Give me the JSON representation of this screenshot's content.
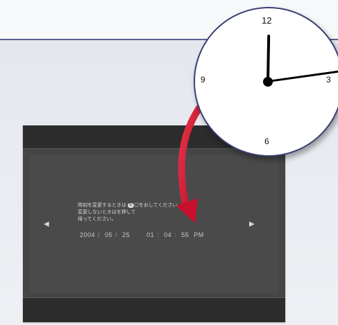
{
  "screen": {
    "message_lines": [
      "時刻を変更するときは",
      "変更しないときは",
      "帰ってください。"
    ],
    "message_line1_tail": "をおしてください。",
    "message_line2_tail": "を押して",
    "button_symbol": "◎",
    "date": {
      "year": "2004",
      "month": "05",
      "day": "25"
    },
    "time": {
      "hour": "01",
      "minute": "04",
      "second": "55",
      "ampm": "PM"
    }
  },
  "clock": {
    "numerals": {
      "n12": "12",
      "n3": "3",
      "n6": "6",
      "n9": "9"
    }
  },
  "icons": {
    "left": "left-arrow",
    "right": "right-arrow"
  },
  "colors": {
    "rule": "#5a608c",
    "arrow": "#c8102e",
    "clock_border": "#3b3f72"
  }
}
